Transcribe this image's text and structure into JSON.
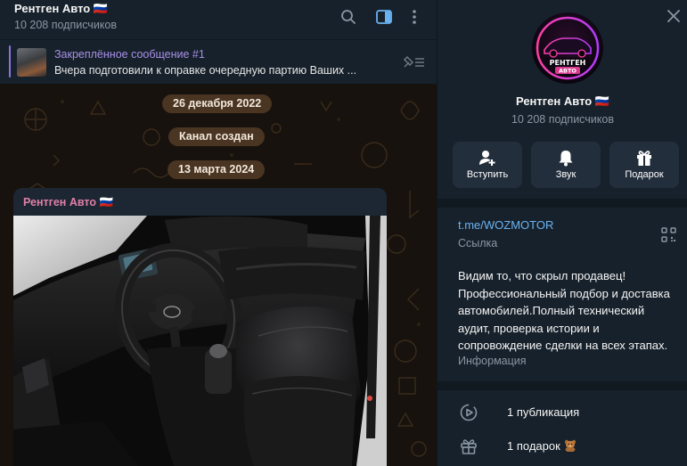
{
  "chat": {
    "title": "Рентген Авто 🇷🇺",
    "subscribers": "10 208 подписчиков",
    "header_icons": [
      "search-icon",
      "sidebar-toggle-icon",
      "more-vertical-icon"
    ],
    "pinned": {
      "title": "Закреплённое сообщение #1",
      "text": "Вчера подготовили к оправке очередную партию Ваших ...",
      "icon": "pinned-list-icon"
    },
    "dates": [
      "26 декабря 2022",
      "13 марта 2024"
    ],
    "service_message": "Канал создан",
    "message": {
      "author": "Рентген Авто 🇷🇺"
    }
  },
  "panel": {
    "close_icon": "close-icon",
    "avatar_logo_text": "РЕНТГЕН АВТО",
    "title": "Рентген Авто 🇷🇺",
    "subscribers": "10 208 подписчиков",
    "actions": [
      {
        "label": "Вступить",
        "icon": "add-user-icon"
      },
      {
        "label": "Звук",
        "icon": "bell-icon"
      },
      {
        "label": "Подарок",
        "icon": "gift-icon"
      }
    ],
    "link": "t.me/WOZMOTOR",
    "link_caption": "Ссылка",
    "description": "Видим то, что скрыл продавец! Профессиональный подбор и доставка автомобилей.Полный технический аудит, проверка истории и сопровождение сделки на всех этапах.",
    "description_caption": "Информация",
    "stats": [
      {
        "label": "1 публикация",
        "icon": "media-play-icon"
      },
      {
        "label": "1 подарок",
        "icon": "gift-icon",
        "extra_icon": "teddy-bear-icon"
      }
    ]
  },
  "colors": {
    "background": "#0e1621",
    "panel": "#17212b",
    "accent_link": "#6ab3f3",
    "pinned_title": "#a890e8",
    "author": "#e07fa7",
    "date_pill": "#4a3522"
  }
}
